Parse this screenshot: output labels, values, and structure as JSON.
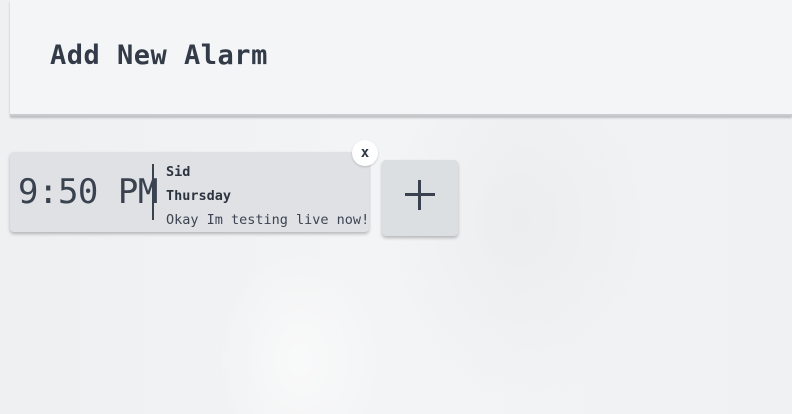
{
  "header": {
    "title": "Add New Alarm"
  },
  "alarms": [
    {
      "time": "9:50 PM",
      "name": "Sid",
      "day": "Thursday",
      "message": "Okay Im testing live now!",
      "delete_label": "x"
    }
  ],
  "add_button": {
    "icon": "plus-icon"
  },
  "colors": {
    "background": "#f1f2f3",
    "card": "#dfe1e4",
    "text": "#2f3744"
  }
}
